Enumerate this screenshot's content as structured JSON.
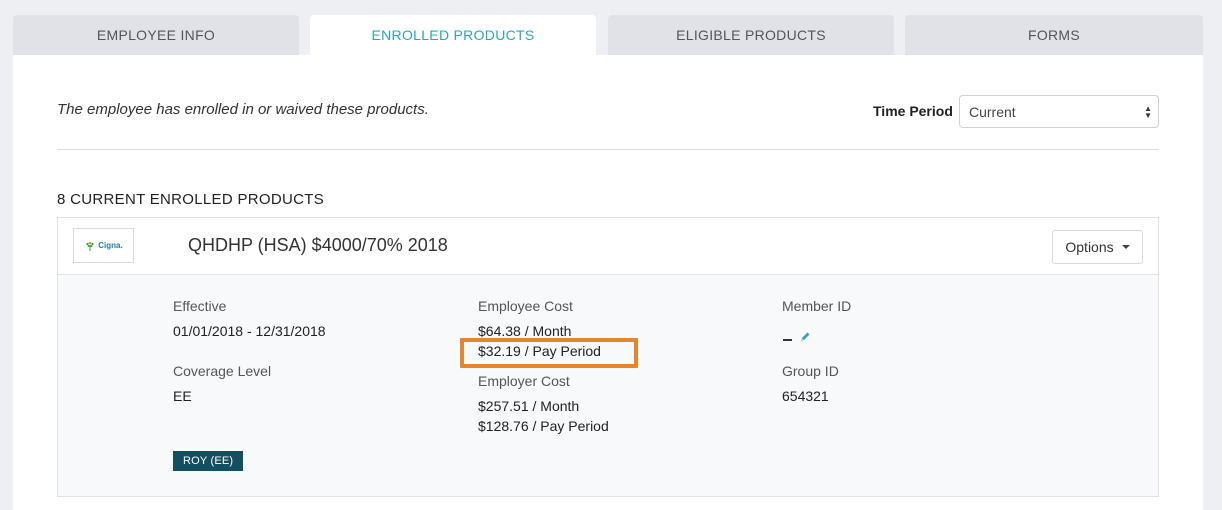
{
  "tabs": [
    {
      "label": "EMPLOYEE INFO"
    },
    {
      "label": "ENROLLED PRODUCTS"
    },
    {
      "label": "ELIGIBLE PRODUCTS"
    },
    {
      "label": "FORMS"
    }
  ],
  "intro_text": "The employee has enrolled in or waived these products.",
  "time_period": {
    "label": "Time Period",
    "selected": "Current"
  },
  "count_heading": "8 CURRENT ENROLLED PRODUCTS",
  "product": {
    "logo_text": "Cigna.",
    "name": "QHDHP (HSA) $4000/70% 2018",
    "options_label": "Options",
    "effective_label": "Effective",
    "effective_value": "01/01/2018 - 12/31/2018",
    "coverage_label": "Coverage Level",
    "coverage_value": "EE",
    "employee_cost_label": "Employee Cost",
    "employee_cost_month": "$64.38 / Month",
    "employee_cost_pay": "$32.19 / Pay Period",
    "employer_cost_label": "Employer Cost",
    "employer_cost_month": "$257.51 / Month",
    "employer_cost_pay": "$128.76 / Pay Period",
    "member_id_label": "Member ID",
    "group_id_label": "Group ID",
    "group_id_value": "654321",
    "badge": "ROY (EE)"
  },
  "colors": {
    "accent": "#2aa8b8",
    "highlight": "#e5862e",
    "badge": "#144f5f"
  }
}
